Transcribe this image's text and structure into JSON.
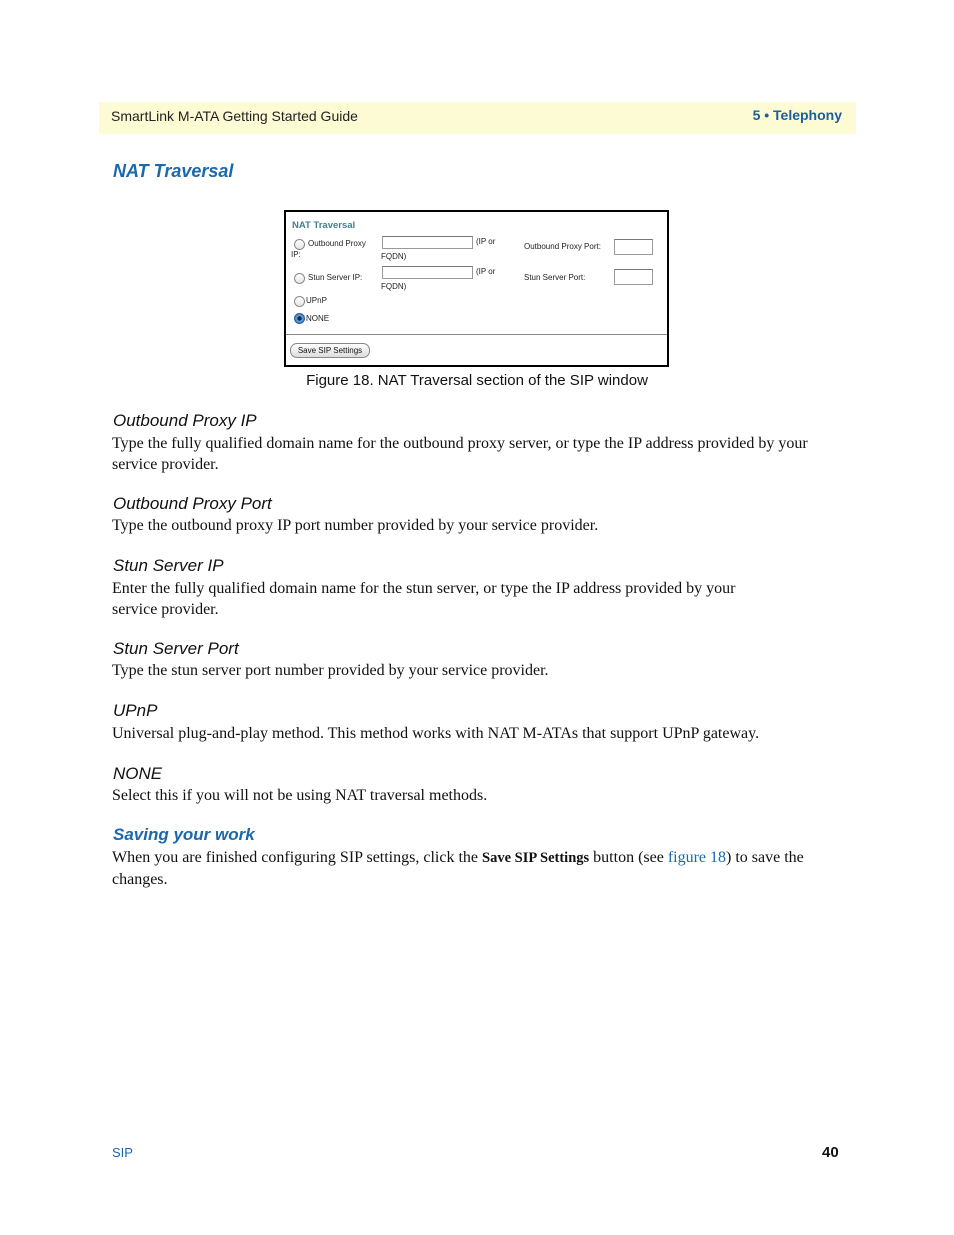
{
  "header": {
    "doc_title": "SmartLink M-ATA Getting Started Guide",
    "chapter": "5 • Telephony",
    "band_color": "#fdfbd3",
    "accent_color": "#1b68ad"
  },
  "section_nat": {
    "title": "NAT Traversal"
  },
  "figure": {
    "panel_title": "NAT Traversal",
    "options": [
      {
        "label_line1": "Outbound Proxy",
        "label_line2": "IP:",
        "selected": false
      },
      {
        "label_line1": "Stun Server IP:",
        "label_line2": "",
        "selected": false
      },
      {
        "label_line1": "UPnP",
        "label_line2": "",
        "selected": false
      },
      {
        "label_line1": "NONE",
        "label_line2": "",
        "selected": true
      }
    ],
    "hint_line1": "(IP or",
    "hint_line2": "FQDN)",
    "outbound_proxy_ip_value": "",
    "stun_server_ip_value": "",
    "outbound_proxy_port_label": "Outbound Proxy Port:",
    "outbound_proxy_port_value": "",
    "stun_server_port_label": "Stun Server Port:",
    "stun_server_port_value": "",
    "save_button": "Save SIP Settings",
    "caption": "Figure 18. NAT Traversal section of the SIP window"
  },
  "fields": [
    {
      "heading": "Outbound Proxy IP",
      "text": "Type the fully qualified domain name for the outbound proxy server, or type the IP address provided by your service provider."
    },
    {
      "heading": "Outbound Proxy Port",
      "text": "Type the outbound proxy IP port number provided by your service provider."
    },
    {
      "heading": "Stun Server IP",
      "text": "Enter the fully qualified domain name for the stun server, or type the IP address provided by your service provider."
    },
    {
      "heading": "Stun Server Port",
      "text": "Type the stun server port number provided by your service provider."
    },
    {
      "heading": "UPnP",
      "text": "Universal plug-and-play method. This method works with NAT M-ATAs that support UPnP gateway."
    },
    {
      "heading": "NONE",
      "text": "Select this if you will not be using NAT traversal methods."
    }
  ],
  "saving": {
    "title": "Saving your work",
    "text_before": "When you are finished configuring SIP settings, click the ",
    "bold": "Save SIP Settings",
    "text_middle": " button (see ",
    "link": "figure 18",
    "text_after": ") to save the changes."
  },
  "footer": {
    "section": "SIP",
    "page_number": "40"
  }
}
